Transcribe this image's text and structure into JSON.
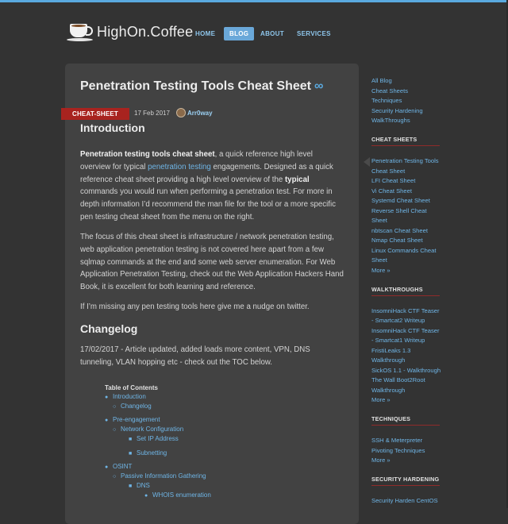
{
  "brand": {
    "title": "HighOn.Coffee"
  },
  "nav": {
    "home": "HOME",
    "blog": "BLOG",
    "about": "ABOUT",
    "services": "SERVICES"
  },
  "article": {
    "title": "Penetration Testing Tools Cheat Sheet",
    "title_symbol": "∞",
    "category": "CHEAT-SHEET",
    "date": "17 Feb 2017",
    "author": "Arr0way",
    "introduction_heading": "Introduction",
    "p1_bold": "Penetration testing tools cheat sheet",
    "p1_a": ", a quick reference high level overview for typical ",
    "p1_link": "penetration testing",
    "p1_b": " engagements. Designed as a quick reference cheat sheet providing a high level overview of the ",
    "p1_bold2": "typical",
    "p1_c": " commands you would run when performing a penetration test. For more in depth information I’d recommend the man file for the tool or a more specific pen testing cheat sheet from the menu on the right.",
    "p2": "The focus of this cheat sheet is infrastructure / network penetration testing, web application penetration testing is not covered here apart from a few sqlmap commands at the end and some web server enumeration. For Web Application Penetration Testing, check out the Web Application Hackers Hand Book, it is excellent for both learning and reference.",
    "p3": "If I’m missing any pen testing tools here give me a nudge on twitter.",
    "changelog_heading": "Changelog",
    "p4": "17/02/2017 - Article updated, added loads more content, VPN, DNS tunneling, VLAN hopping etc - check out the TOC below."
  },
  "toc": {
    "title": "Table of Contents",
    "items": [
      {
        "label": "Introduction",
        "level": 1
      },
      {
        "label": "Changelog",
        "level": 2
      },
      {
        "label": "Pre-engagement",
        "level": 1
      },
      {
        "label": "Network Configuration",
        "level": 2
      },
      {
        "label": "Set IP Address",
        "level": 3
      },
      {
        "label": "Subnetting",
        "level": 3
      },
      {
        "label": "OSINT",
        "level": 1
      },
      {
        "label": "Passive Information Gathering",
        "level": 2
      },
      {
        "label": "DNS",
        "level": 3
      },
      {
        "label": "WHOIS enumeration",
        "level": 4
      }
    ]
  },
  "sidebar": {
    "top_links": [
      "All Blog",
      "Cheat Sheets",
      "Techniques",
      "Security Hardening",
      "WalkThroughs"
    ],
    "cheat_sheets": {
      "heading": "CHEAT SHEETS",
      "links": [
        "Penetration Testing Tools",
        "Cheat Sheet",
        "LFI Cheat Sheet",
        "Vi Cheat Sheet",
        "Systemd Cheat Sheet",
        "Reverse Shell Cheat",
        "Sheet",
        "nbtscan Cheat Sheet",
        "Nmap Cheat Sheet",
        "Linux Commands Cheat",
        "Sheet",
        "More »"
      ]
    },
    "walkthroughs": {
      "heading": "WALKTHROUGHS",
      "links": [
        "InsomniHack CTF Teaser",
        "- Smartcat2 Writeup",
        "InsomniHack CTF Teaser",
        "- Smartcat1 Writeup",
        "FristiLeaks 1.3",
        "Walkthrough",
        "SickOS 1.1 - Walkthrough",
        "The Wall Boot2Root",
        "Walkthrough",
        "More »"
      ]
    },
    "techniques": {
      "heading": "TECHNIQUES",
      "links": [
        "SSH & Meterpreter",
        "Pivoting Techniques",
        "More »"
      ]
    },
    "security_hardening": {
      "heading": "SECURITY HARDENING",
      "links": [
        "Security Harden CentOS"
      ]
    }
  },
  "colors": {
    "accent": "#5aa9df",
    "ribbon": "#a8231f",
    "background": "#333333",
    "panel": "#424242"
  }
}
